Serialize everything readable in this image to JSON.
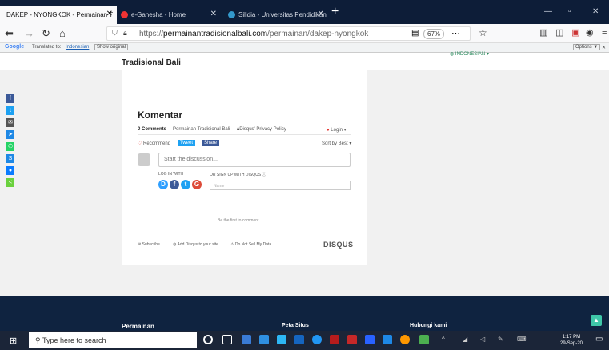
{
  "browser": {
    "tabs": [
      {
        "label": "DAKEP - NYONGKOK - Permainan T"
      },
      {
        "label": "e-Ganesha - Home"
      },
      {
        "label": "Silidia - Universitas Pendidikan"
      }
    ],
    "url_prefix": "https://",
    "url_domain": "permainantradisionalbali.com",
    "url_path": "/permainan/dakep-nyongkok",
    "zoom": "67%"
  },
  "translate_bar": {
    "google": "Google",
    "translated_to": "Translated to:",
    "language": "Indonesian",
    "show_original": "Show original",
    "options": "Options ▼"
  },
  "site": {
    "brand": "Tradisional Bali",
    "language_menu": "INDONESIAN"
  },
  "comments": {
    "title": "Komentar",
    "count": "0 Comments",
    "community": "Permainan Tradisional Bali",
    "privacy": "Disqus' Privacy Policy",
    "login": "Login",
    "recommend": "Recommend",
    "tweet": "Tweet",
    "share": "Share",
    "sort": "Sort by Best",
    "discussion_placeholder": "Start the discussion...",
    "log_in_with": "LOG IN WITH",
    "sign_up": "OR SIGN UP WITH DISQUS",
    "name_placeholder": "Name",
    "empty": "Be the first to comment.",
    "subscribe": "Subscribe",
    "add_disqus": "Add Disqus to your site",
    "do_not_sell": "Do Not Sell My Data",
    "disqus_logo": "DISQUS"
  },
  "footer": {
    "col1": "Permainan",
    "col2": "Peta Situs",
    "col3": "Hubungi kami"
  },
  "taskbar": {
    "search": "Type here to search",
    "time": "1:17 PM",
    "date": "29-Sep-20"
  }
}
